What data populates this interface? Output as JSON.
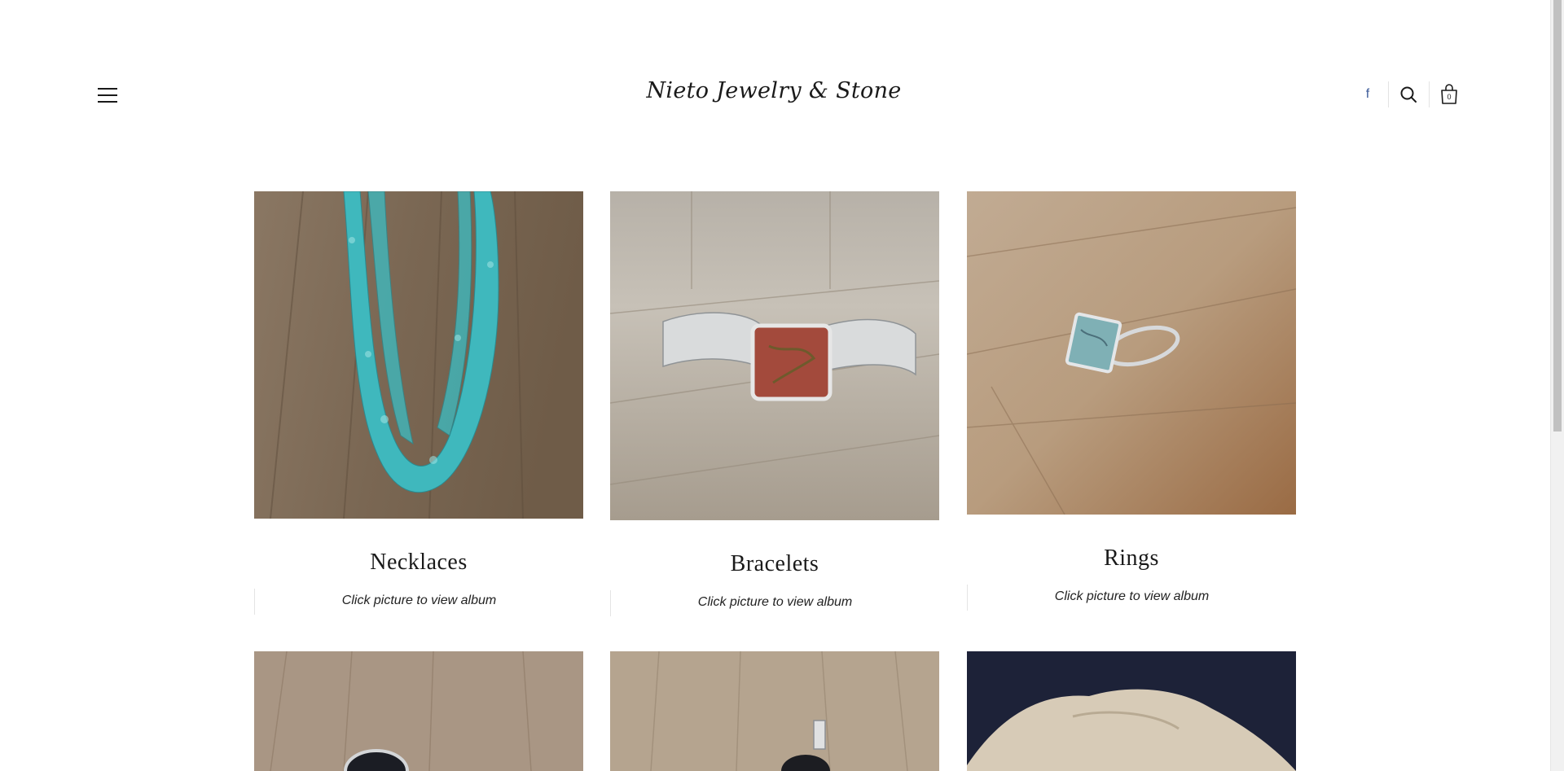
{
  "header": {
    "site_title": "Nieto Jewelry & Stone",
    "cart_count": "0",
    "icons": {
      "menu": "hamburger-menu-icon",
      "facebook": "facebook-icon",
      "search": "search-icon",
      "cart": "shopping-bag-icon"
    },
    "facebook_glyph": "f",
    "facebook_color": "#3b5998"
  },
  "gallery": {
    "items": [
      {
        "title": "Necklaces",
        "subtitle": "Click picture to view album",
        "image": "turquoise chip necklace on wood"
      },
      {
        "title": "Bracelets",
        "subtitle": "Click picture to view album",
        "image": "silver cuff bracelet with red stone on wood"
      },
      {
        "title": "Rings",
        "subtitle": "Click picture to view album",
        "image": "abalone silver ring on wood"
      },
      {
        "title": "",
        "subtitle": "",
        "image": "black onyx pendant on wood"
      },
      {
        "title": "",
        "subtitle": "",
        "image": "silver pendant on wood"
      },
      {
        "title": "",
        "subtitle": "",
        "image": "stone on dark blue background"
      }
    ]
  }
}
